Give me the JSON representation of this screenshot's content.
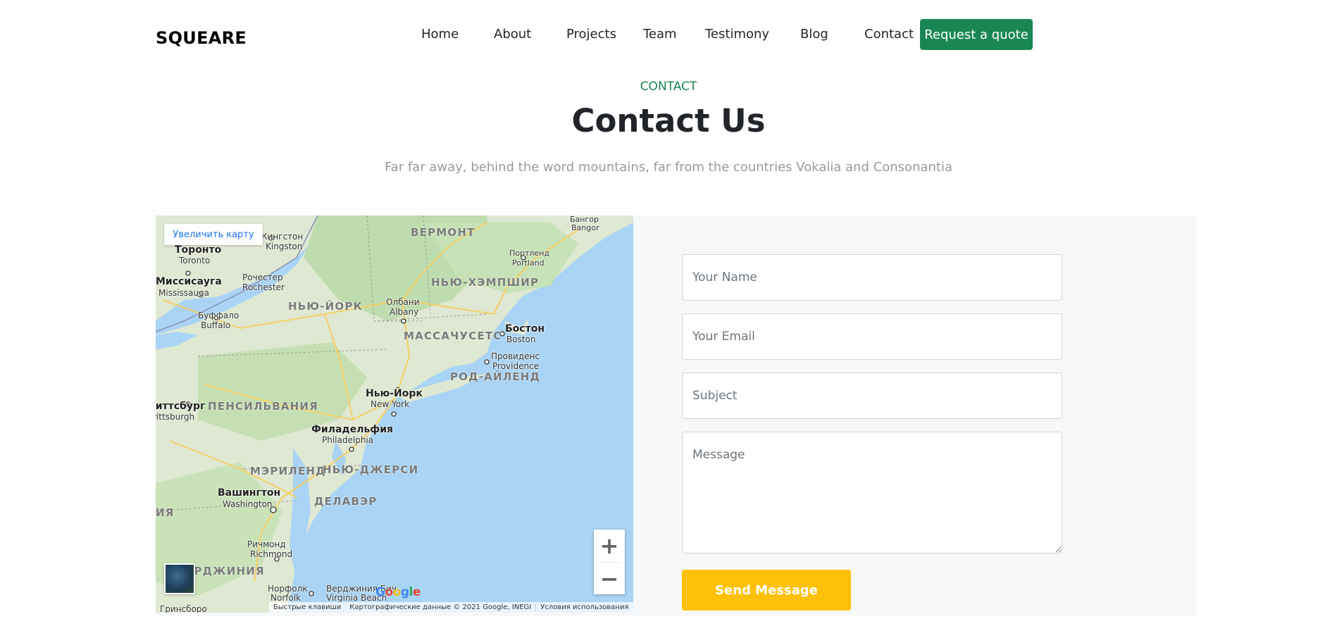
{
  "nav": {
    "brand": "SQUEARE",
    "links": [
      "Home",
      "About",
      "Projects",
      "Team",
      "Testimony",
      "Blog",
      "Contact"
    ],
    "cta": "Request a quote"
  },
  "header": {
    "eyebrow": "CONTACT",
    "title": "Contact Us",
    "subtitle": "Far far away, behind the word mountains, far from the countries Vokalia and Consonantia"
  },
  "map": {
    "enlarge_label": "Увеличить карту",
    "labels": {
      "kingston": "Кингстон",
      "kingston_en": "Kingston",
      "vermont": "ВЕРМОНТ",
      "bangor": "Бангор",
      "bangor_en": "Bangor",
      "toronto": "Торонто",
      "toronto_en": "Toronto",
      "portland": "Портленд",
      "portland_en": "Portland",
      "mississauga": "Миссисауга",
      "mississauga_en": "Mississauga",
      "rochester": "Рочестер",
      "rochester_en": "Rochester",
      "new_hampshire": "НЬЮ-ХЭМПШИР",
      "ny_state": "НЬЮ-ЙОРК",
      "albany": "Олбани",
      "albany_en": "Albany",
      "buffalo": "Буффало",
      "buffalo_en": "Buffalo",
      "boston": "Бостон",
      "boston_en": "Boston",
      "massachusetts": "МАССАЧУСЕТС",
      "providence": "Провиденс",
      "providence_en": "Providence",
      "rhode_island": "РОД-АЙЛЕНД",
      "new_york": "Нью-Йорк",
      "new_york_en": "New York",
      "pittsburgh": "Питтсбург",
      "pittsburgh_en": "Pittsburgh",
      "pennsylvania": "ПЕНСИЛЬВАНИЯ",
      "philadelphia": "Филадельфия",
      "philadelphia_en": "Philadelphia",
      "maryland": "МЭРИЛЕНД",
      "new_jersey": "НЬЮ-ДЖЕРСИ",
      "washington": "Вашингтон",
      "washington_en": "Washington",
      "delaware": "ДЕЛАВЭР",
      "va_partial": "ИЯ",
      "richmond": "Ричмонд",
      "richmond_en": "Richmond",
      "virginia": "ВИРДЖИНИЯ",
      "norfolk": "Норфолк",
      "norfolk_en": "Norfolk",
      "virginia_beach": "Верджиния Бич",
      "virginia_beach_en": "Virginia Beach",
      "greensboro": "Гринсборо"
    },
    "zoom_in": "+",
    "zoom_out": "−",
    "attribution": {
      "shortcuts": "Быстрые клавиши",
      "data": "Картографические данные © 2021 Google, INEGI",
      "terms": "Условия использования"
    },
    "google_logo": "Google"
  },
  "form": {
    "name_placeholder": "Your Name",
    "email_placeholder": "Your Email",
    "subject_placeholder": "Subject",
    "message_placeholder": "Message",
    "submit_label": "Send Message"
  }
}
